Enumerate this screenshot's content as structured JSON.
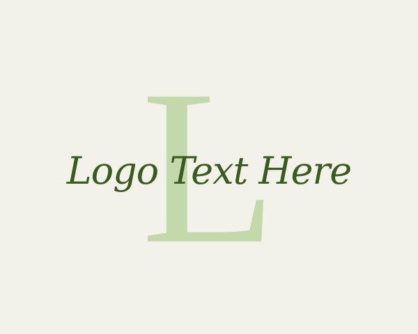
{
  "logo": {
    "monogram": "L",
    "text": "Logo Text Here",
    "colors": {
      "background": "#f2f2eb",
      "monogram": "#c3d9ab",
      "text": "#3b5a1f"
    }
  }
}
